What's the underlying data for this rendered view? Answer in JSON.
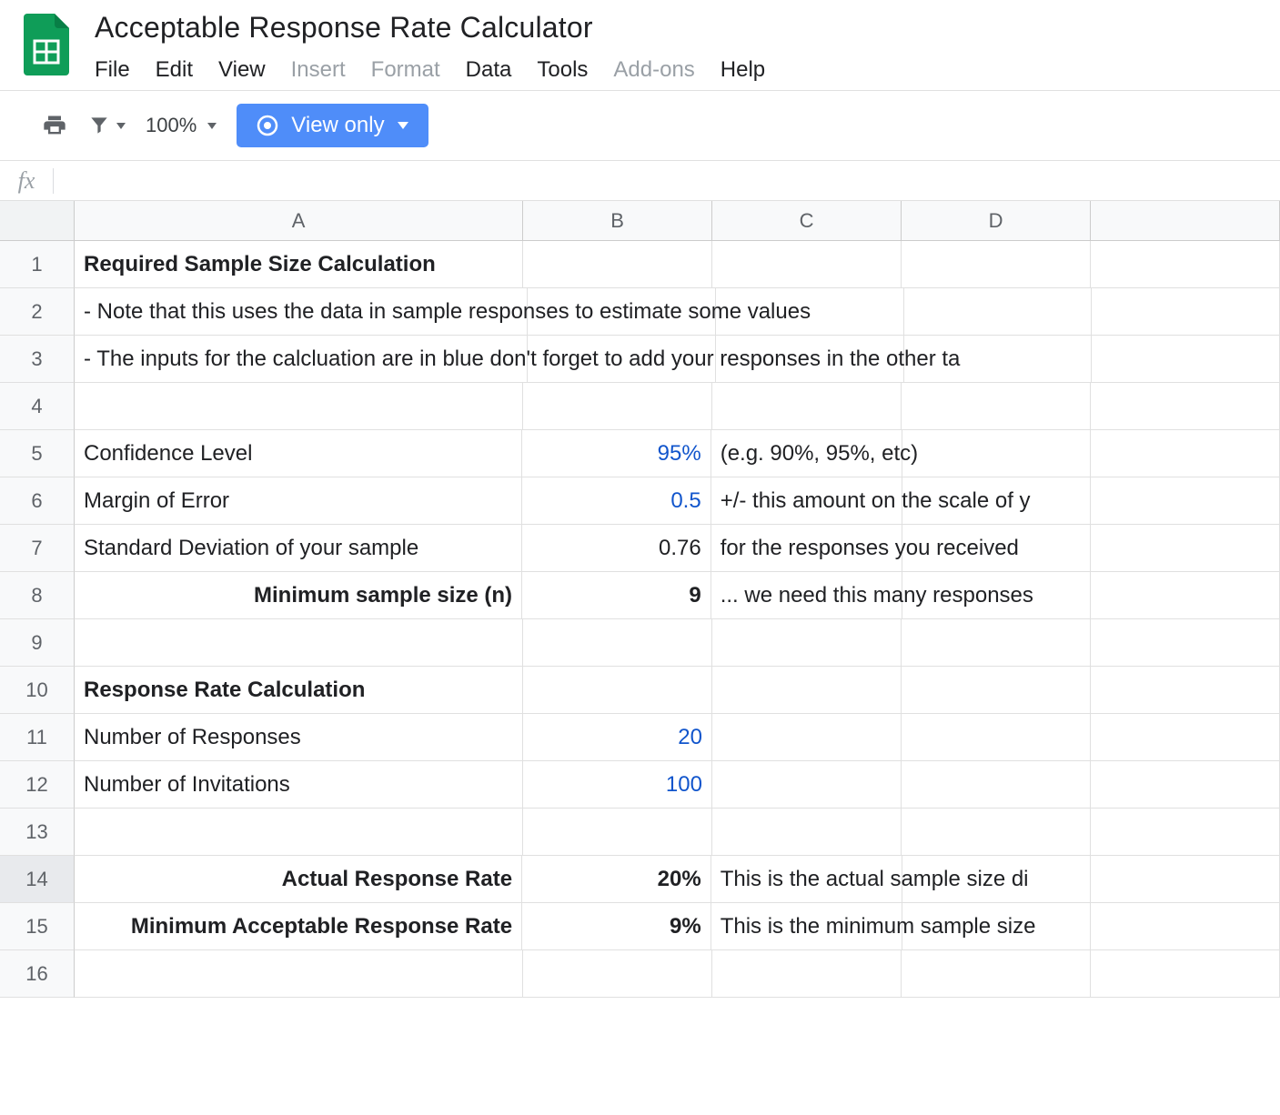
{
  "doc": {
    "title": "Acceptable Response Rate Calculator"
  },
  "menus": {
    "file": "File",
    "edit": "Edit",
    "view": "View",
    "insert": "Insert",
    "format": "Format",
    "data": "Data",
    "tools": "Tools",
    "addons": "Add-ons",
    "help": "Help"
  },
  "toolbar": {
    "zoom": "100%",
    "view_only": "View only"
  },
  "fx": {
    "label": "fx",
    "value": ""
  },
  "columns": {
    "A": "A",
    "B": "B",
    "C": "C",
    "D": "D",
    "E": ""
  },
  "chart_data": {
    "type": "table",
    "title": "Acceptable Response Rate Calculator",
    "rows": [
      {
        "n": 1,
        "A": "Required Sample Size Calculation",
        "A_bold": true
      },
      {
        "n": 2,
        "A": "- Note that this uses the data in sample responses to estimate some values"
      },
      {
        "n": 3,
        "A": "- The inputs for the calcluation are in blue don't forget to add your responses in the other ta"
      },
      {
        "n": 4
      },
      {
        "n": 5,
        "A": "Confidence Level",
        "B": "95%",
        "B_blue": true,
        "C": "(e.g. 90%, 95%, etc)"
      },
      {
        "n": 6,
        "A": "Margin of Error",
        "B": "0.5",
        "B_blue": true,
        "C": "+/- this amount on the scale of y"
      },
      {
        "n": 7,
        "A": "Standard Deviation of your sample",
        "B": "0.76",
        "C": "for the responses you received"
      },
      {
        "n": 8,
        "A": "Minimum sample size (n)",
        "A_bold": true,
        "A_right": true,
        "B": "9",
        "B_bold": true,
        "C": "... we need this many responses"
      },
      {
        "n": 9
      },
      {
        "n": 10,
        "A": "Response Rate Calculation",
        "A_bold": true
      },
      {
        "n": 11,
        "A": "Number of Responses",
        "B": "20",
        "B_blue": true
      },
      {
        "n": 12,
        "A": "Number of Invitations",
        "B": "100",
        "B_blue": true
      },
      {
        "n": 13
      },
      {
        "n": 14,
        "A": "Actual Response Rate",
        "A_bold": true,
        "A_right": true,
        "B": "20%",
        "B_bold": true,
        "C": "This is the actual sample size di"
      },
      {
        "n": 15,
        "A": "Minimum Acceptable Response Rate",
        "A_bold": true,
        "A_right": true,
        "B": "9%",
        "B_bold": true,
        "C": "This is the minimum sample size"
      },
      {
        "n": 16
      }
    ]
  }
}
